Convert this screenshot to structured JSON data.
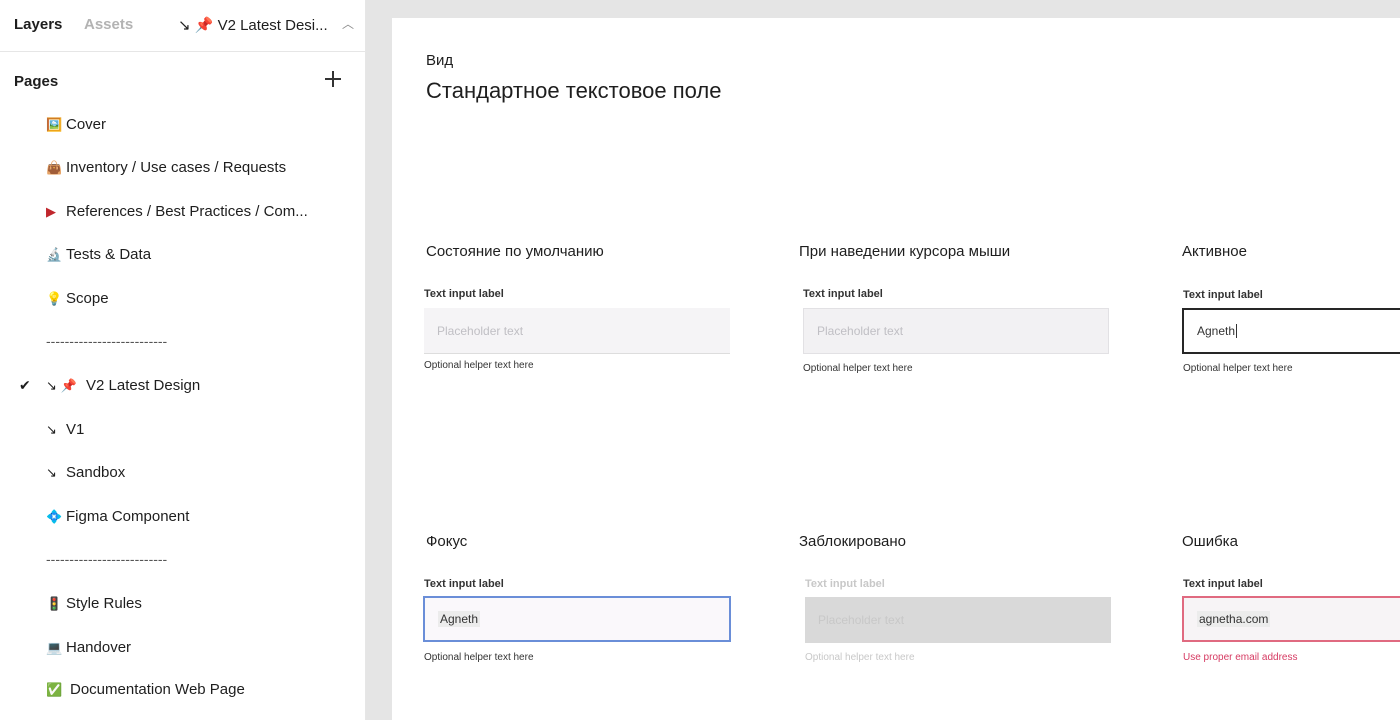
{
  "sidebar": {
    "tabs": {
      "layers": "Layers",
      "assets": "Assets"
    },
    "current_page": "↘ 📌 V2 Latest Desi...",
    "pages_header": "Pages",
    "items": [
      {
        "emoji": "🖼️",
        "label": "Cover"
      },
      {
        "emoji": "👜",
        "label": "Inventory / Use cases / Requests"
      },
      {
        "emoji": "▶",
        "label": "References  / Best Practices / Com..."
      },
      {
        "emoji": "🔬",
        "label": "Tests & Data"
      },
      {
        "emoji": "💡",
        "label": "Scope"
      },
      {
        "divider": "--------------------------"
      },
      {
        "emoji": "↘ 📌",
        "label": "V2  Latest Design",
        "selected": true
      },
      {
        "emoji": "↘",
        "label": "V1"
      },
      {
        "emoji": "↘",
        "label": "Sandbox"
      },
      {
        "emoji": "💠",
        "label": "Figma Component"
      },
      {
        "divider": "--------------------------"
      },
      {
        "emoji": "🚦",
        "label": "Style Rules"
      },
      {
        "emoji": "💻",
        "label": "Handover"
      },
      {
        "emoji": "✅",
        "label": "Documentation Web Page"
      }
    ]
  },
  "canvas": {
    "overline": "Вид",
    "title": "Стандартное текстовое поле",
    "states": {
      "default": {
        "title": "Состояние по умолчанию",
        "label": "Text input label",
        "placeholder": "Placeholder text",
        "helper": "Optional helper text here"
      },
      "hover": {
        "title": "При наведении курсора мыши",
        "label": "Text input label",
        "placeholder": "Placeholder text",
        "helper": "Optional helper text here"
      },
      "active": {
        "title": "Активное",
        "label": "Text input label",
        "value": "Agneth",
        "helper": "Optional helper text here"
      },
      "focus": {
        "title": "Фокус",
        "label": "Text input label",
        "value": "Agneth",
        "helper": "Optional helper text here"
      },
      "disabled": {
        "title": "Заблокировано",
        "label": "Text input label",
        "placeholder": "Placeholder text",
        "helper": "Optional helper text here"
      },
      "error": {
        "title": "Ошибка",
        "label": "Text input label",
        "value": "agnetha.com",
        "helper": "Use proper email address"
      }
    }
  },
  "colors": {
    "focus_border": "#6a8ed8",
    "error_border": "#e06a80",
    "error_text": "#d63a62",
    "active_border": "#262626"
  }
}
